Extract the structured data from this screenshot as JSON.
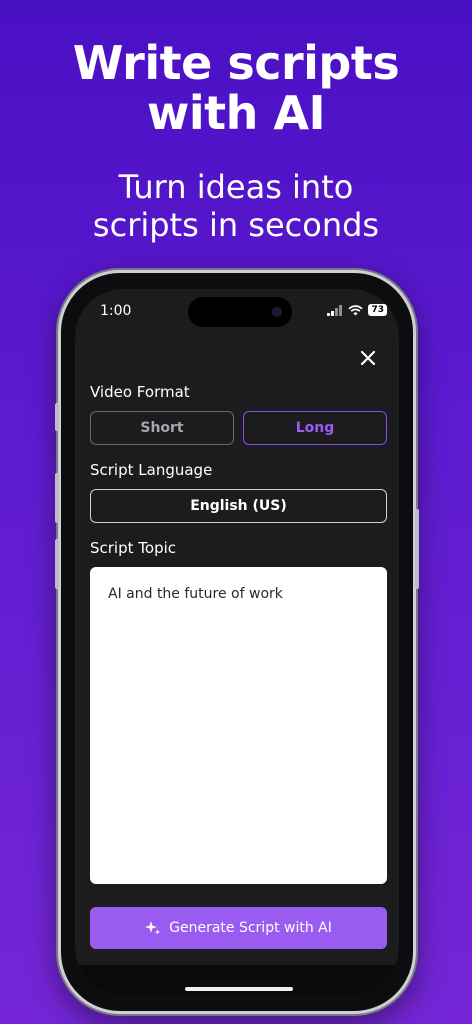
{
  "promo": {
    "headline_line1": "Write scripts",
    "headline_line2": "with AI",
    "subline_line1": "Turn ideas into",
    "subline_line2": "scripts in seconds"
  },
  "status_bar": {
    "time": "1:00",
    "battery": "73"
  },
  "form": {
    "close_icon": "×",
    "video_format_label": "Video Format",
    "format_options": [
      "Short",
      "Long"
    ],
    "selected_format": "Long",
    "script_language_label": "Script Language",
    "language_value": "English (US)",
    "script_topic_label": "Script Topic",
    "topic_value": "AI and the future of work",
    "generate_button_label": "Generate Script with AI"
  },
  "colors": {
    "background_top": "#4a10c4",
    "background_bottom": "#7426d6",
    "accent": "#9a5cf0",
    "screen_bg": "#1c1c1e"
  }
}
